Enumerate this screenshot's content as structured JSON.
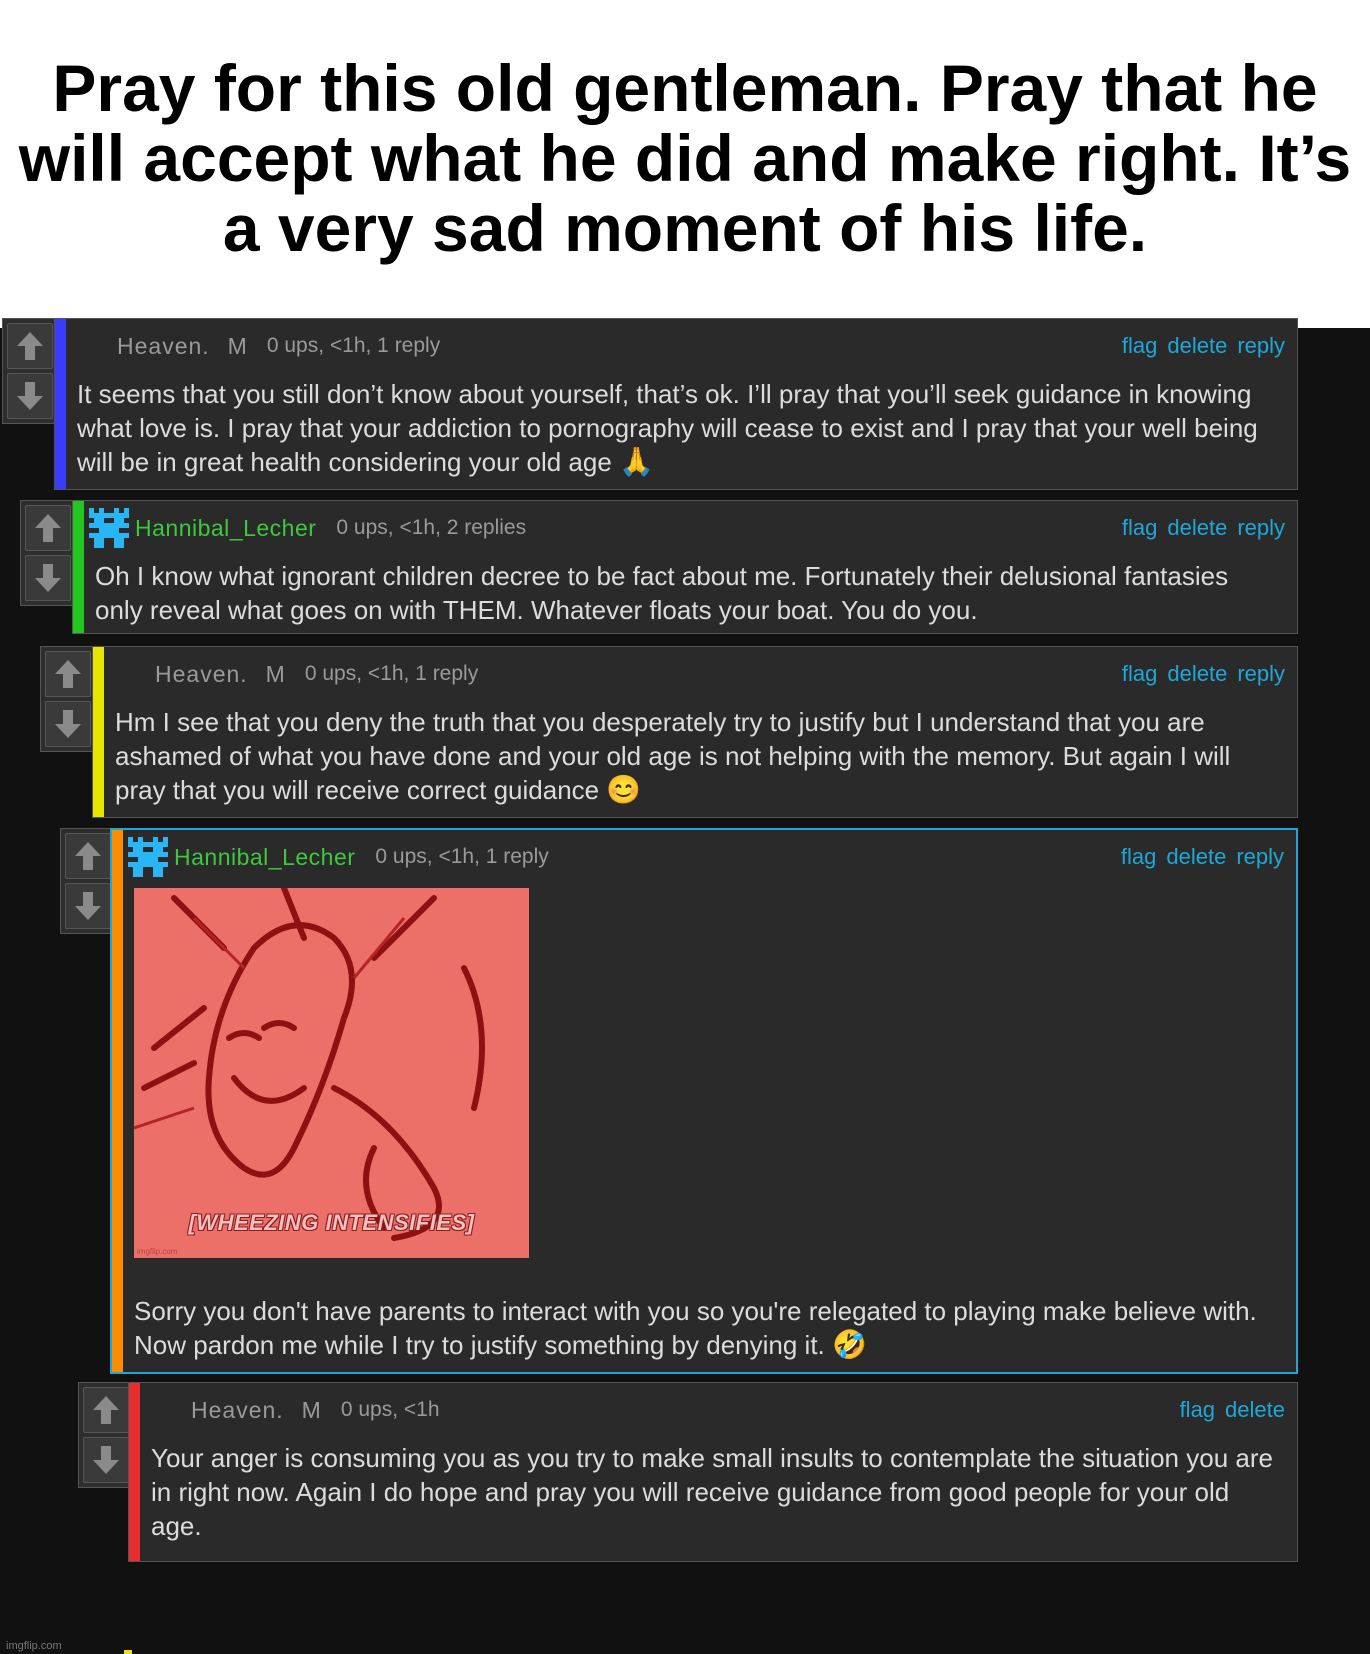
{
  "caption": "Pray for this old gentleman. Pray that he will accept what he did and make right. It’s a very sad moment of his life.",
  "actions": {
    "flag": "flag",
    "delete": "delete",
    "reply": "reply"
  },
  "colors": {
    "level1": "#3b3bff",
    "level2": "#22c722",
    "level3": "#e6e600",
    "level4": "#ff8c00",
    "level5": "#e62e2e",
    "link": "#1ea7d8",
    "username_green": "#3ec83e"
  },
  "comments": [
    {
      "username": "Heaven.",
      "gender": "M",
      "meta": "0 ups, <1h, 1 reply",
      "text": "It seems that you still don’t know about yourself, that’s ok. I’ll pray that you’ll seek guidance in knowing what love is. I pray that your addiction to pornography will cease to exist and I pray that your well being will be in great health considering your old age",
      "emoji": "🙏",
      "emoji_name": "praying-hands-icon"
    },
    {
      "username": "Hannibal_Lecher",
      "avatar": "pixel-avatar-icon",
      "meta": "0 ups, <1h, 2 replies",
      "text": "Oh I know what ignorant children decree to be fact about me. Fortunately their delusional fantasies only reveal what goes on with THEM. Whatever floats your boat. You do you."
    },
    {
      "username": "Heaven.",
      "gender": "M",
      "meta": "0 ups, <1h, 1 reply",
      "text": "Hm I see that you deny the truth that you desperately try to justify but I understand that you are ashamed of what you have done and your old age is not helping with the memory. But again I will pray that you will receive correct guidance",
      "emoji": "😊",
      "emoji_name": "smiling-face-icon"
    },
    {
      "username": "Hannibal_Lecher",
      "avatar": "pixel-avatar-icon",
      "meta": "0 ups, <1h, 1 reply",
      "image_caption": "[WHEEZING INTENSIFIES]",
      "image_watermark": "imgflip.com",
      "text": "Sorry you don't have parents to interact with you so you're relegated to playing make believe with. Now pardon me while I try to justify something by denying it.",
      "emoji": "🤣",
      "emoji_name": "rolling-laughing-icon"
    },
    {
      "username": "Heaven.",
      "gender": "M",
      "meta": "0 ups, <1h",
      "text": "Your anger is consuming you as you try to make small insults to contemplate the situation you are in right now. Again I do hope and pray you will receive guidance from good people for your old age."
    }
  ],
  "watermark": "imgflip.com"
}
